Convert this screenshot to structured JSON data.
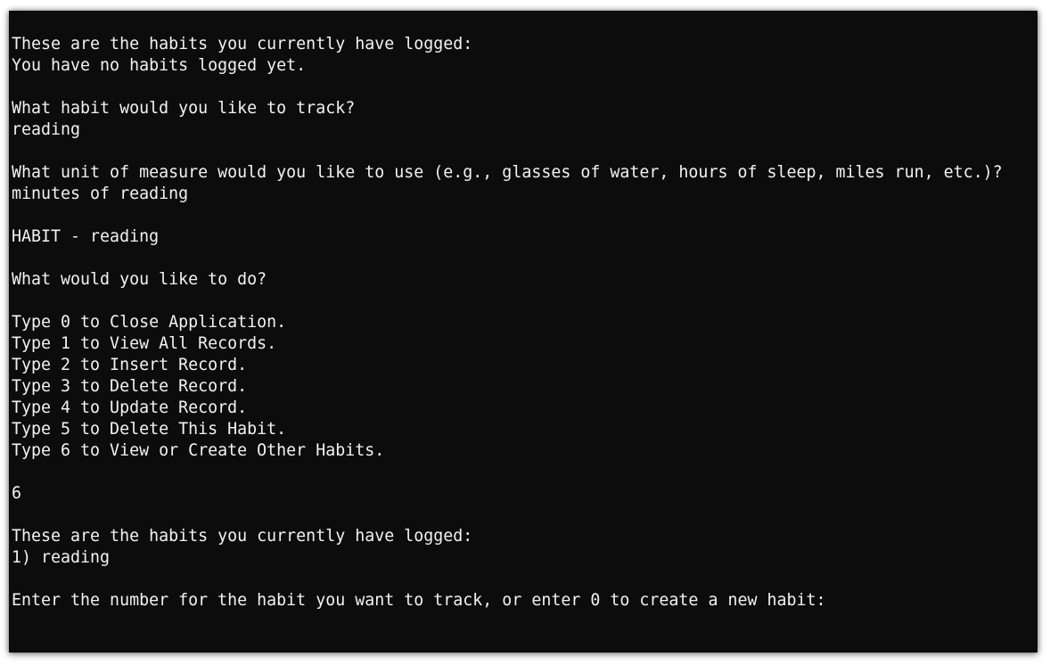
{
  "console": {
    "lines": [
      "These are the habits you currently have logged:",
      "You have no habits logged yet.",
      "",
      "What habit would you like to track?",
      "reading",
      "",
      "What unit of measure would you like to use (e.g., glasses of water, hours of sleep, miles run, etc.)?",
      "minutes of reading",
      "",
      "HABIT - reading",
      "",
      "What would you like to do?",
      "",
      "Type 0 to Close Application.",
      "Type 1 to View All Records.",
      "Type 2 to Insert Record.",
      "Type 3 to Delete Record.",
      "Type 4 to Update Record.",
      "Type 5 to Delete This Habit.",
      "Type 6 to View or Create Other Habits.",
      "",
      "6",
      "",
      "These are the habits you currently have logged:",
      "1) reading",
      "",
      "Enter the number for the habit you want to track, or enter 0 to create a new habit:"
    ]
  },
  "colors": {
    "background": "#0c0c0c",
    "foreground": "#f2f2f2"
  }
}
